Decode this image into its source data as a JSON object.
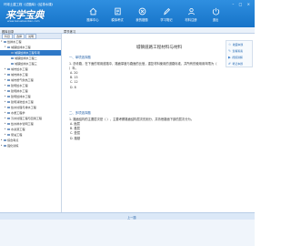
{
  "window": {
    "title": "环球土建工程《试题库》《给排水课》",
    "controls": "– □ ×"
  },
  "logo": {
    "text": "来学宝典",
    "subtitle": "www.lexuebaodian.com"
  },
  "nav": [
    {
      "label": "题库中心",
      "icon": "home-icon"
    },
    {
      "label": "模拟考试",
      "icon": "exam-icon"
    },
    {
      "label": "我的错题",
      "icon": "wrong-icon"
    },
    {
      "label": "学习笔记",
      "icon": "note-icon"
    },
    {
      "label": "材料注册",
      "icon": "register-icon"
    },
    {
      "label": "退出",
      "icon": "exit-icon"
    }
  ],
  "tabs": {
    "left": "题库目录",
    "right": "章节练习"
  },
  "sidebar": {
    "tabs": [
      "科目",
      "选择",
      "说明"
    ],
    "items": [
      {
        "label": "给排水工程",
        "level": 0,
        "twisty": "▾",
        "selected": false
      },
      {
        "label": "城镇给排水工程",
        "level": 1,
        "twisty": "▾",
        "selected": false
      },
      {
        "label": "城镇给排水工程专项",
        "level": 2,
        "twisty": "",
        "selected": true
      },
      {
        "label": "城镇给排水工程二",
        "level": 2,
        "twisty": "",
        "selected": false
      },
      {
        "label": "城镇给排水工程三",
        "level": 2,
        "twisty": "",
        "selected": false
      },
      {
        "label": "城市给水工程",
        "level": 1,
        "twisty": "▸",
        "selected": false
      },
      {
        "label": "城市排水工程",
        "level": 1,
        "twisty": "▸",
        "selected": false
      },
      {
        "label": "城市燃气供热工程",
        "level": 1,
        "twisty": "▸",
        "selected": false
      },
      {
        "label": "建筑给水工程",
        "level": 1,
        "twisty": "▸",
        "selected": false
      },
      {
        "label": "建筑排水工程",
        "level": 1,
        "twisty": "▸",
        "selected": false
      },
      {
        "label": "建筑给排水工程",
        "level": 1,
        "twisty": "▸",
        "selected": false
      },
      {
        "label": "建筑消防给水工程",
        "level": 1,
        "twisty": "▸",
        "selected": false
      },
      {
        "label": "给水处理与排水工程",
        "level": 1,
        "twisty": "▸",
        "selected": false
      },
      {
        "label": "水质工程学",
        "level": 1,
        "twisty": "▸",
        "selected": false
      },
      {
        "label": "污水处理工程与回用工程",
        "level": 1,
        "twisty": "▸",
        "selected": false
      },
      {
        "label": "给水排水管网工程",
        "level": 1,
        "twisty": "▸",
        "selected": false
      },
      {
        "label": "水资源工程",
        "level": 1,
        "twisty": "▸",
        "selected": false
      },
      {
        "label": "泵站工程",
        "level": 1,
        "twisty": "▸",
        "selected": false
      },
      {
        "label": "综合考点",
        "level": 0,
        "twisty": "▸",
        "selected": false
      },
      {
        "label": "强化训练",
        "level": 0,
        "twisty": "▸",
        "selected": false
      }
    ]
  },
  "content": {
    "title": "城镇道路工程材料与材料",
    "tools": [
      {
        "label": "收藏本题",
        "icon": "star-icon"
      },
      {
        "label": "查看答案",
        "icon": "answer-icon"
      },
      {
        "label": "视频讲解",
        "icon": "video-icon"
      },
      {
        "label": "笔记本题",
        "icon": "note-icon"
      }
    ],
    "sections": [
      {
        "head": "一、单项选择题",
        "question": "1. 沥青路，在下面的常用道路中，路面厚度与路面的比值，重复材料使用的道路标准，并所有的使用用年限为（ ）年。",
        "options": [
          "A. 20",
          "B. 15",
          "C. 12",
          "D. 8"
        ]
      },
      {
        "head": "二、多项选择题",
        "question": "1. 路面结构的主要层次是（ ），主要考察路面结构层次的划分，并熟悉路面下部的层次分为。",
        "options": [
          "A. 面层",
          "B. 基层",
          "C. 垫层",
          "D. 路基"
        ]
      }
    ]
  },
  "bottom": {
    "prev_label": "上一题"
  }
}
